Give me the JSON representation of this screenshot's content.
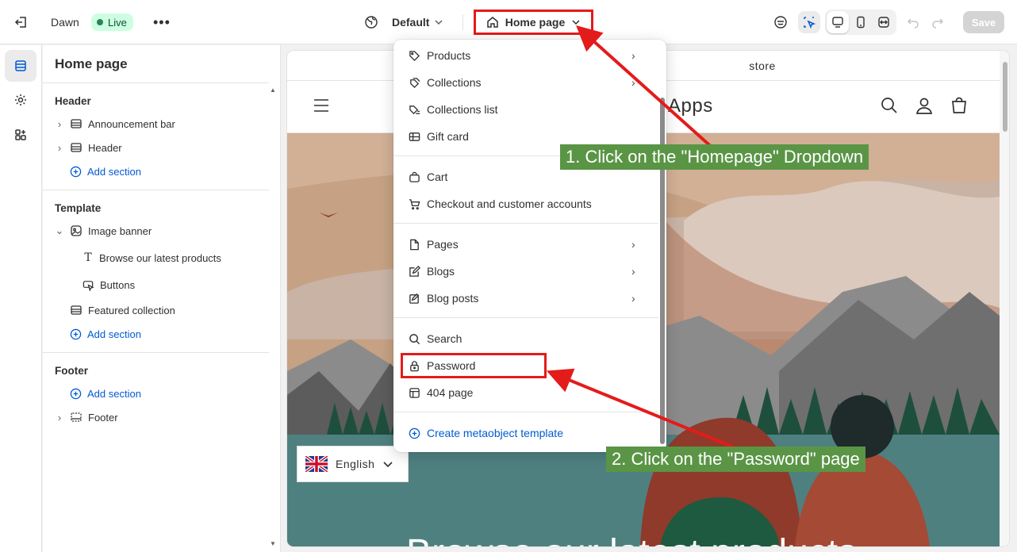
{
  "topbar": {
    "store_name": "Dawn",
    "live_label": "Live",
    "more_label": "•••",
    "theme_label": "Default",
    "page_label": "Home page",
    "save_label": "Save"
  },
  "sidebar": {
    "title": "Home page",
    "header_group": "Header",
    "header_items": [
      "Announcement bar",
      "Header"
    ],
    "add_section": "Add section",
    "template_group": "Template",
    "image_banner": "Image banner",
    "browse_label": "Browse our latest products",
    "buttons_label": "Buttons",
    "featured": "Featured collection",
    "footer_group": "Footer",
    "footer_item": "Footer"
  },
  "preview": {
    "announcement": "store",
    "logo_text": "Apps",
    "language": "English",
    "banner_heading": "Browse our latest products"
  },
  "dropdown": {
    "items": [
      {
        "label": "Products",
        "icon": "tag-icon"
      },
      {
        "label": "Collections",
        "icon": "collection-icon"
      },
      {
        "label": "Collections list",
        "icon": "collections-list-icon"
      },
      {
        "label": "Gift card",
        "icon": "gift-card-icon"
      },
      {
        "label": "Cart",
        "icon": "cart-icon"
      },
      {
        "label": "Checkout and customer accounts",
        "icon": "checkout-icon"
      },
      {
        "label": "Pages",
        "icon": "page-icon"
      },
      {
        "label": "Blogs",
        "icon": "blog-icon"
      },
      {
        "label": "Blog posts",
        "icon": "blog-post-icon"
      },
      {
        "label": "Search",
        "icon": "search-icon"
      },
      {
        "label": "Password",
        "icon": "lock-icon"
      },
      {
        "label": "404 page",
        "icon": "404-icon"
      },
      {
        "label": "Create metaobject template",
        "icon": "plus-circle-icon"
      }
    ]
  },
  "annotations": {
    "step1": "1. Click on the \"Homepage\" Dropdown",
    "step2": "2. Click on the \"Password\" page"
  },
  "colors": {
    "accent_blue": "#005bd3",
    "highlight_red": "#e41b1b",
    "callout_green": "#5a9545",
    "live_badge": "#cdfee1"
  }
}
